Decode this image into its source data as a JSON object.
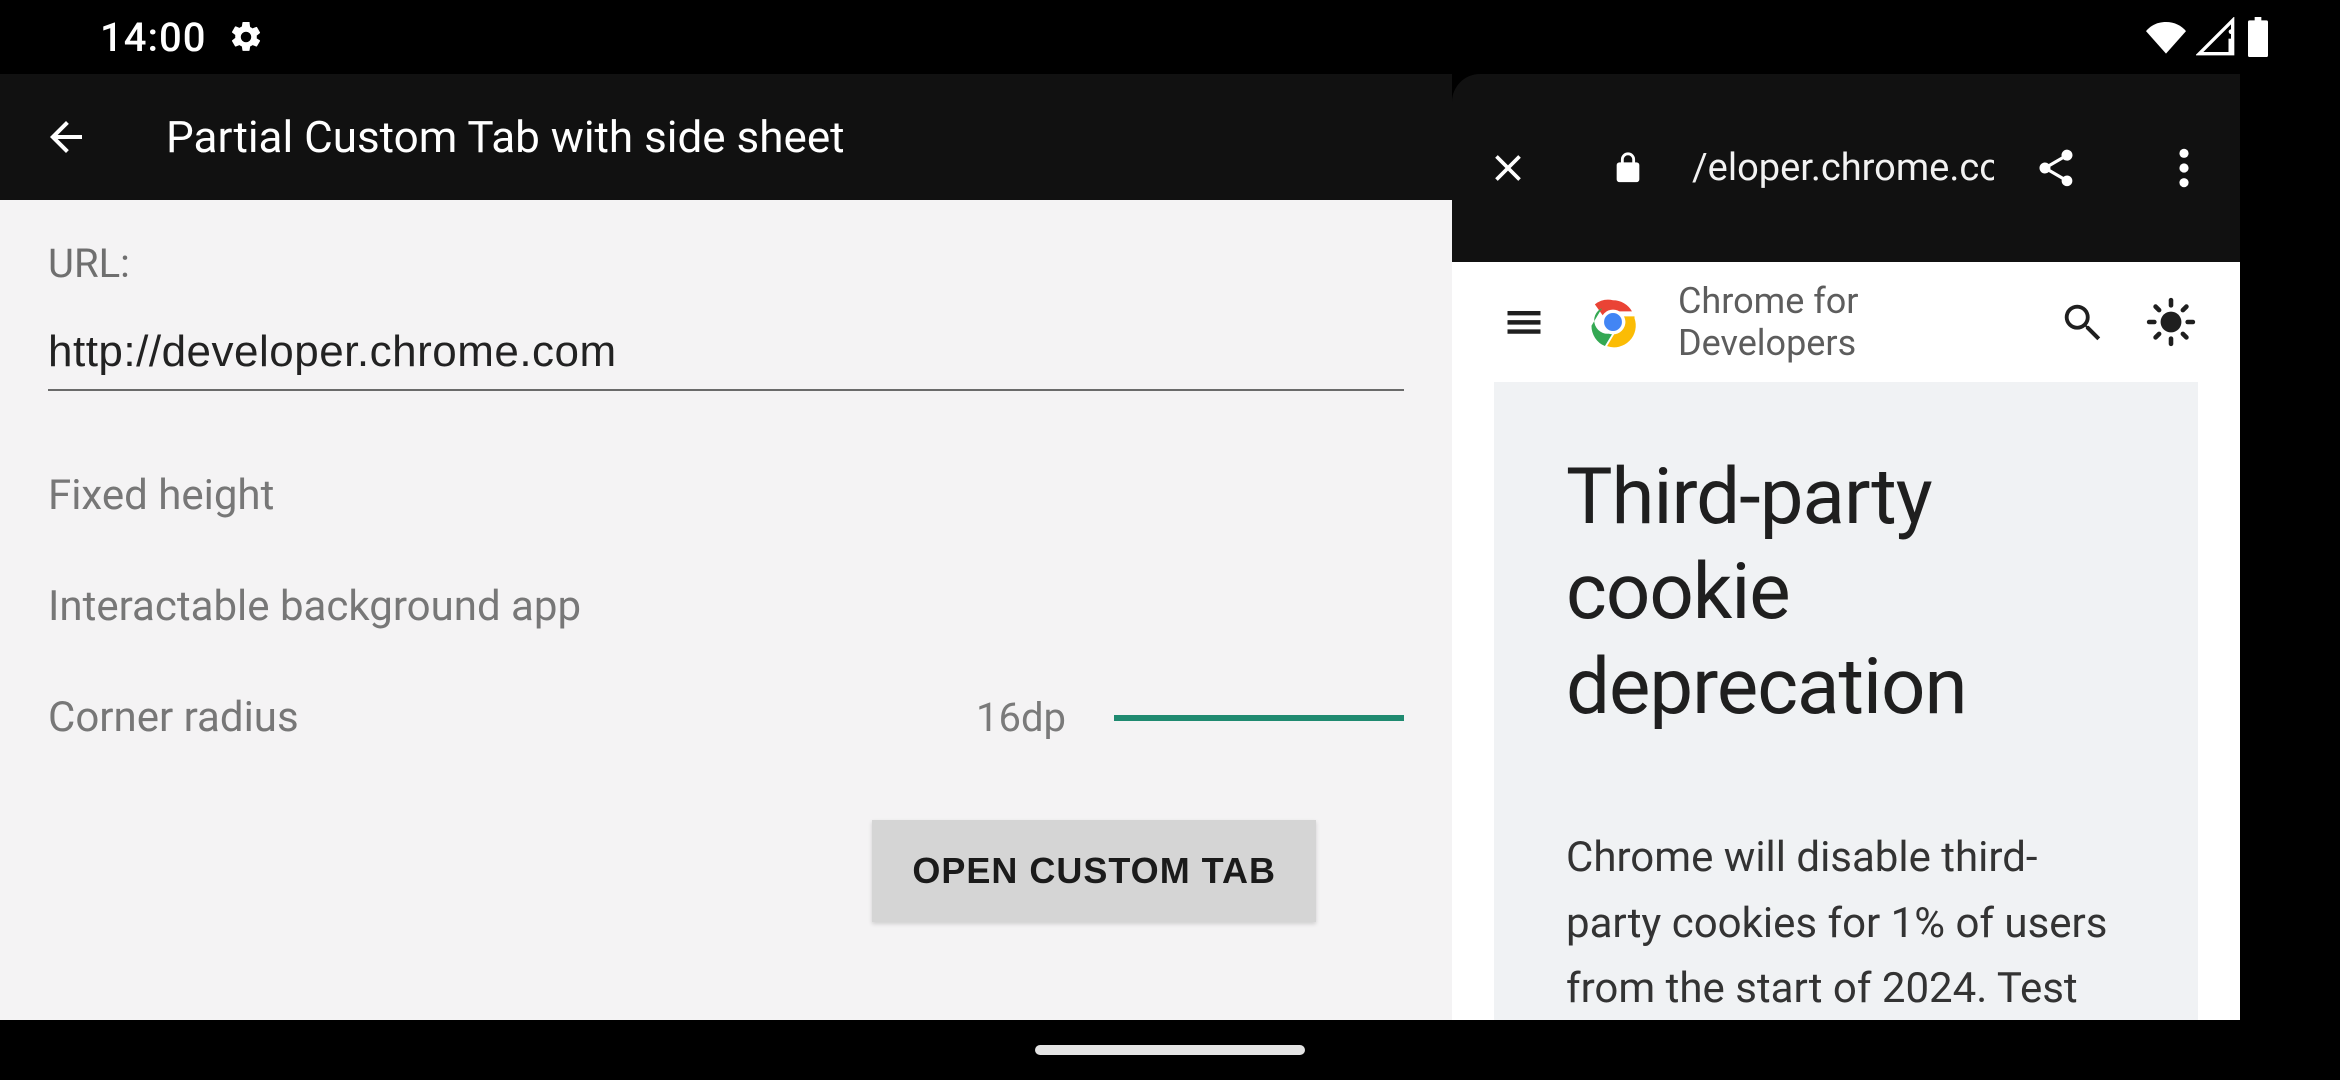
{
  "statusbar": {
    "time": "14:00"
  },
  "appbar": {
    "title": "Partial Custom Tab with side sheet"
  },
  "config": {
    "url_label": "URL:",
    "url_value": "http://developer.chrome.com",
    "fixed_height_label": "Fixed height",
    "interactable_bg_label": "Interactable background app",
    "corner_radius_label": "Corner radius",
    "corner_radius_value": "16dp",
    "open_button_label": "OPEN CUSTOM TAB"
  },
  "custom_tab": {
    "url_display": "/eloper.chrome.com",
    "site": {
      "title": "Chrome for Developers"
    },
    "article": {
      "heading": "Third-party cookie deprecation",
      "body": "Chrome will disable third-party cookies for 1% of users from the start of 2024. Test your site now for"
    }
  }
}
